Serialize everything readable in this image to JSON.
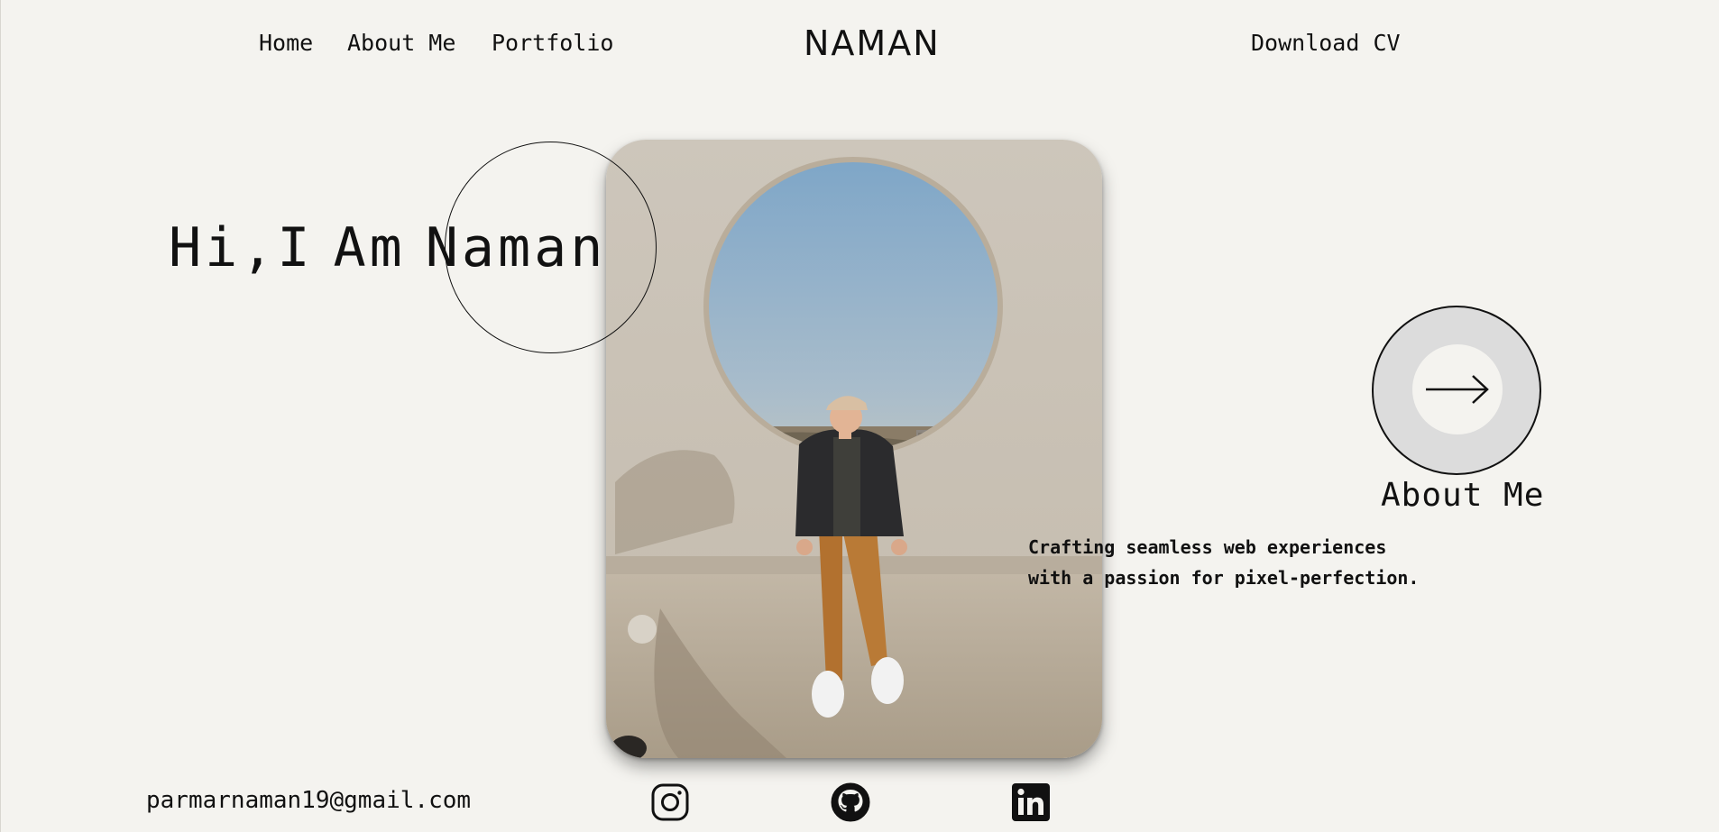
{
  "nav": {
    "home": "Home",
    "about": "About Me",
    "portfolio": "Portfolio",
    "brand": "NAMAN",
    "download_cv": "Download CV"
  },
  "hero": {
    "greeting": "Hi,I",
    "am": "Am",
    "name": "Naman",
    "photo_icon": "profile-photo"
  },
  "about_cta": {
    "label": "About Me",
    "icon": "arrow-right-icon"
  },
  "tagline": {
    "line1": "Crafting seamless web experiences",
    "line2": "with a passion for pixel-perfection."
  },
  "footer": {
    "email": "parmarnaman19@gmail.com",
    "social": [
      {
        "icon": "instagram-icon"
      },
      {
        "icon": "github-icon"
      },
      {
        "icon": "linkedin-icon"
      }
    ]
  },
  "colors": {
    "background": "#f4f3ef",
    "text": "#111111",
    "cta_fill": "#dcdcdc"
  }
}
